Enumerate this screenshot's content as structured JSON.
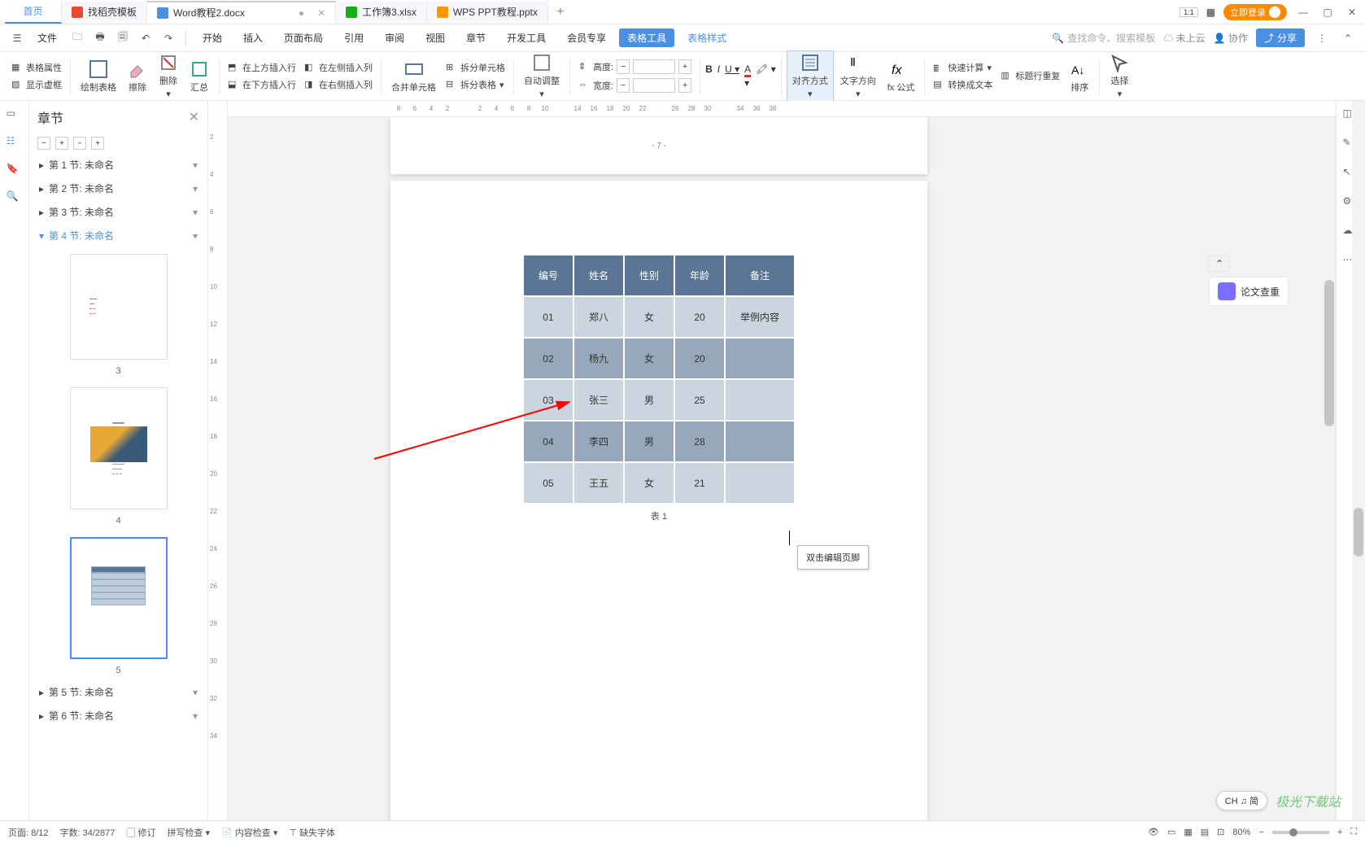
{
  "tabs": {
    "home": "首页",
    "t1": "找稻壳模板",
    "t2": "Word教程2.docx",
    "t3": "工作簿3.xlsx",
    "t4": "WPS PPT教程.pptx"
  },
  "login": "立即登录",
  "menu": {
    "file": "文件",
    "items": [
      "开始",
      "插入",
      "页面布局",
      "引用",
      "审阅",
      "视图",
      "章节",
      "开发工具",
      "会员专享"
    ],
    "active": "表格工具",
    "link": "表格样式",
    "search": "查找命令、搜索模板",
    "cloud": "未上云",
    "coop": "协作",
    "share": "分享"
  },
  "ribbon": {
    "g1a": "表格属性",
    "g1b": "显示虚框",
    "g2": "绘制表格",
    "g3": "擦除",
    "g4": "删除",
    "g5": "汇总",
    "g6a": "在上方插入行",
    "g6b": "在下方插入行",
    "g6c": "在左侧插入列",
    "g6d": "在右侧插入列",
    "g7": "合并单元格",
    "g8a": "拆分单元格",
    "g8b": "拆分表格",
    "g9": "自动调整",
    "g10a": "高度:",
    "g10b": "宽度:",
    "g11": "对齐方式",
    "g12": "文字方向",
    "g13": "fx 公式",
    "g14a": "快速计算",
    "g14b": "标题行重复",
    "g14c": "转换成文本",
    "g15": "排序",
    "g16": "选择"
  },
  "nav": {
    "title": "章节",
    "sections": [
      "第 1 节: 未命名",
      "第 2 节: 未命名",
      "第 3 节: 未命名",
      "第 4 节: 未命名",
      "第 5 节: 未命名",
      "第 6 节: 未命名"
    ],
    "thumb_labels": [
      "3",
      "4",
      "5"
    ]
  },
  "doc": {
    "pagenum": "- 7 -",
    "headers": [
      "编号",
      "姓名",
      "性别",
      "年龄",
      "备注"
    ],
    "rows": [
      [
        "01",
        "郑八",
        "女",
        "20",
        "举例内容"
      ],
      [
        "02",
        "杨九",
        "女",
        "20",
        ""
      ],
      [
        "03",
        "张三",
        "男",
        "25",
        ""
      ],
      [
        "04",
        "李四",
        "男",
        "28",
        ""
      ],
      [
        "05",
        "王五",
        "女",
        "21",
        ""
      ]
    ],
    "caption": "表 1",
    "tooltip": "双击编辑页脚"
  },
  "chart_data": {
    "type": "table",
    "title": "表 1",
    "columns": [
      "编号",
      "姓名",
      "性别",
      "年龄",
      "备注"
    ],
    "rows": [
      {
        "编号": "01",
        "姓名": "郑八",
        "性别": "女",
        "年龄": 20,
        "备注": "举例内容"
      },
      {
        "编号": "02",
        "姓名": "杨九",
        "性别": "女",
        "年龄": 20,
        "备注": ""
      },
      {
        "编号": "03",
        "姓名": "张三",
        "性别": "男",
        "年龄": 25,
        "备注": ""
      },
      {
        "编号": "04",
        "姓名": "李四",
        "性别": "男",
        "年龄": 28,
        "备注": ""
      },
      {
        "编号": "05",
        "姓名": "王五",
        "性别": "女",
        "年龄": 21,
        "备注": ""
      }
    ]
  },
  "float": {
    "plagiarism": "论文查重"
  },
  "ime": "CH ♫ 简",
  "watermark": "极光下载站",
  "status": {
    "page": "页面: 8/12",
    "words": "字数: 34/2877",
    "track": "修订",
    "spell": "拼写检查",
    "content": "内容检查",
    "missing": "缺失字体",
    "zoom": "80%"
  },
  "hruler": [
    "8",
    "6",
    "4",
    "2",
    "",
    "2",
    "4",
    "6",
    "8",
    "10",
    "",
    "14",
    "16",
    "18",
    "20",
    "22",
    "",
    "26",
    "28",
    "30",
    "",
    "34",
    "36",
    "38"
  ],
  "vruler": [
    "2",
    "4",
    "6",
    "8",
    "10",
    "12",
    "14",
    "16",
    "18",
    "20",
    "22",
    "24",
    "26",
    "28",
    "30",
    "32",
    "34"
  ]
}
